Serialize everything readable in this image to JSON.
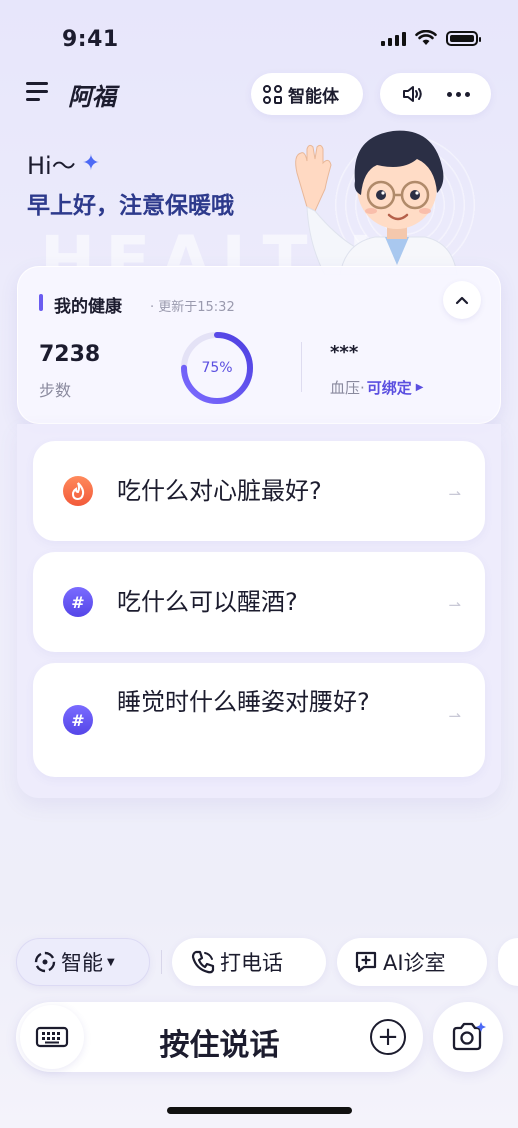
{
  "status_bar": {
    "time": "9:41"
  },
  "header": {
    "app_name": "阿福",
    "agent_label": "智能体"
  },
  "greeting": {
    "hi": "Hi～",
    "message": "早上好，注意保暖哦"
  },
  "health": {
    "title": "我的健康",
    "updated": "· 更新于15:32",
    "steps_value": "7238",
    "steps_label": "步数",
    "progress_percent": 75,
    "progress_label": "75%",
    "bp_value": "***",
    "bp_label": "血压·",
    "bp_link": "可绑定"
  },
  "questions": [
    {
      "text": "吃什么对心脏最好?",
      "icon": "flame-icon"
    },
    {
      "text": "吃什么可以醒酒?",
      "icon": "hashtag-icon"
    },
    {
      "text": "睡觉时什么睡姿对腰好?",
      "icon": "hashtag-icon"
    }
  ],
  "quick_actions": {
    "smart": "智能",
    "call": "打电话",
    "clinic": "AI诊室"
  },
  "input": {
    "talk_label": "按住说话"
  },
  "colors": {
    "accent": "#5b4fe0",
    "greeting": "#2d3a8c",
    "flame": "#f25a3a"
  }
}
